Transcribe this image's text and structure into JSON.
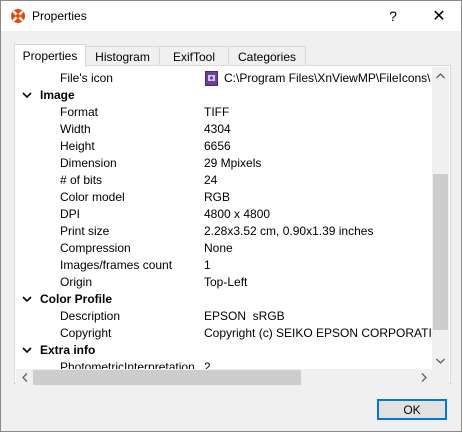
{
  "window": {
    "title": "Properties",
    "help_label": "?",
    "close_label": "✕"
  },
  "tabs": [
    {
      "label": "Properties",
      "active": true
    },
    {
      "label": "Histogram",
      "active": false
    },
    {
      "label": "ExifTool",
      "active": false
    },
    {
      "label": "Categories",
      "active": false
    }
  ],
  "properties": {
    "file_icon_row": {
      "name": "File's icon",
      "value": "C:\\Program Files\\XnViewMP\\FileIcons\\"
    },
    "sections": [
      {
        "label": "Image",
        "rows": [
          {
            "name": "Format",
            "value": "TIFF"
          },
          {
            "name": "Width",
            "value": "4304"
          },
          {
            "name": "Height",
            "value": "6656"
          },
          {
            "name": "Dimension",
            "value": "29 Mpixels"
          },
          {
            "name": "# of bits",
            "value": "24"
          },
          {
            "name": "Color model",
            "value": "RGB"
          },
          {
            "name": "DPI",
            "value": "4800 x 4800"
          },
          {
            "name": "Print size",
            "value": "2.28x3.52 cm, 0.90x1.39 inches"
          },
          {
            "name": "Compression",
            "value": "None"
          },
          {
            "name": "Images/frames count",
            "value": "1"
          },
          {
            "name": "Origin",
            "value": "Top-Left"
          }
        ]
      },
      {
        "label": "Color Profile",
        "rows": [
          {
            "name": "Description",
            "value": "EPSON  sRGB"
          },
          {
            "name": "Copyright",
            "value": "Copyright (c) SEIKO EPSON CORPORATION"
          }
        ]
      },
      {
        "label": "Extra info",
        "rows": [
          {
            "name": "PhotometricInterpretation",
            "value": "2"
          }
        ]
      }
    ]
  },
  "buttons": {
    "ok_label": "OK"
  },
  "icons": {
    "app": "xnview-app-icon",
    "file": "file-type-icon",
    "expand": "chevron-down-icon"
  },
  "colors": {
    "accent": "#0078d7",
    "app_icon": "#e8470d",
    "file_icon": "#6a3fa0"
  }
}
